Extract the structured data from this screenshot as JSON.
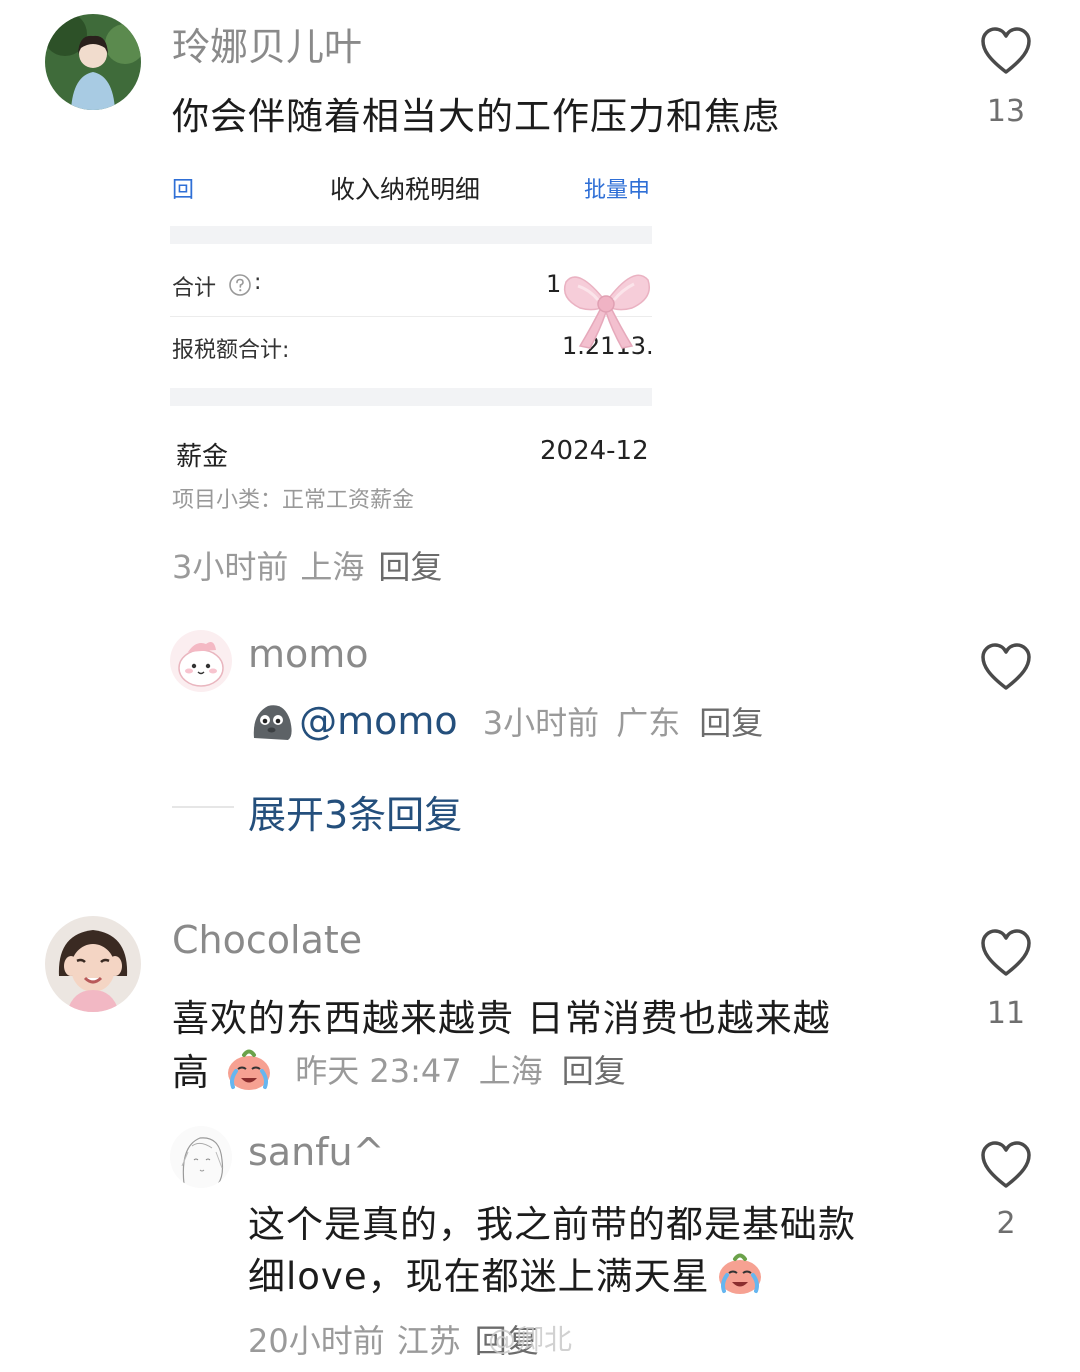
{
  "comments": [
    {
      "username": "玲娜贝儿叶",
      "text": "你会伴随着相当大的工作压力和焦虑",
      "likes": "13",
      "time": "3小时前",
      "location": "上海",
      "reply_label": "回复",
      "embedded_screenshot": {
        "back_label": "回",
        "title": "收入纳税明细",
        "action_label": "批量申",
        "row1_label": "合计",
        "row1_suffix": ":",
        "row1_value": "1",
        "row2_label": "报税额合计:",
        "row2_value": "1.2113.",
        "item_label": "薪金",
        "item_date": "2024-12",
        "item_sub": "项目小类：正常工资薪金"
      },
      "replies": [
        {
          "username": "momo",
          "mention": "@momo",
          "time": "3小时前",
          "location": "广东",
          "reply_label": "回复"
        }
      ],
      "expand_label": "展开3条回复"
    },
    {
      "username": "Chocolate",
      "text_line1": "喜欢的东西越来越贵 日常消费也越来越",
      "text_line2": "高",
      "likes": "11",
      "time": "昨天 23:47",
      "location": "上海",
      "reply_label": "回复",
      "replies": [
        {
          "username": "sanfu^",
          "text_line1": "这个是真的，我之前带的都是基础款",
          "text_line2": "细love，现在都迷上满天星",
          "likes": "2",
          "time": "20小时前",
          "location": "江苏",
          "reply_label": "回复"
        }
      ]
    }
  ],
  "watermark": "@卿北",
  "colors": {
    "username": "#8a8a8a",
    "text": "#1c1c1c",
    "meta": "#9a9a9a",
    "link": "#244f7c",
    "accent_blue": "#2f6fd6"
  },
  "icons": [
    "heart-outline-icon",
    "question-circle-icon",
    "crying-emoji-icon",
    "grey-blob-emoji-icon",
    "bow-sticker"
  ]
}
